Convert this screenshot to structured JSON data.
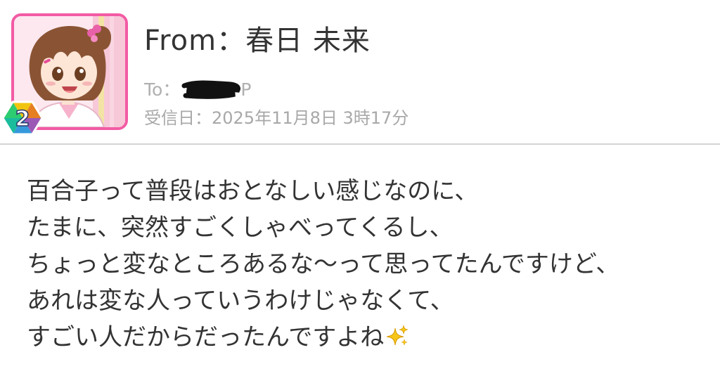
{
  "header": {
    "from_label": "From：",
    "from_name": "春日 未来",
    "to_label": "To：",
    "to_suffix": "P",
    "received_label": "受信日：",
    "received_datetime": "2025年11月8日 3時17分",
    "avatar_rank": "2"
  },
  "message": {
    "lines": [
      "百合子って普段はおとなしい感じなのに、",
      "たまに、突然すごくしゃべってくるし、",
      "ちょっと変なところあるな～って思ってたんですけど、",
      "あれは変な人っていうわけじゃなくて、",
      "すごい人だからだったんですよね"
    ]
  },
  "icons": {
    "avatar": "character-portrait",
    "badge": "rank-badge-icon",
    "emoji": "sparkles-icon"
  },
  "colors": {
    "avatar_frame": "#f25ba4",
    "text_primary": "#333333",
    "text_secondary": "#a8a8a8",
    "divider": "#d4d4d4"
  }
}
